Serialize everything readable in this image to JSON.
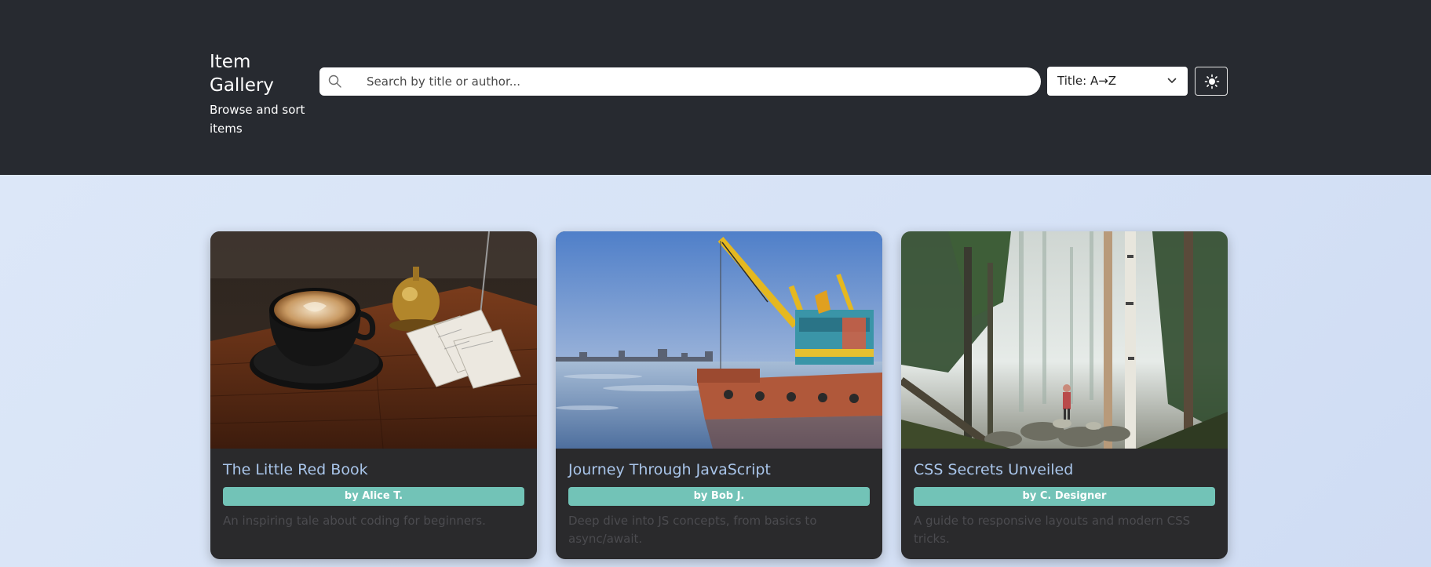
{
  "header": {
    "title": "Item Gallery",
    "subtitle": "Browse and sort items",
    "search": {
      "placeholder": "Search by title or author...",
      "value": "",
      "icon": "search-icon"
    },
    "sort": {
      "selected": "Title: A→Z",
      "icon": "chevron-down-icon"
    },
    "theme_toggle": {
      "icon": "sun-icon"
    }
  },
  "colors": {
    "header_bg": "#272a30",
    "page_bg": "#dde8f8",
    "card_bg": "#2a2a2c",
    "card_title": "#a9c5ea",
    "author_badge": "#72c3b7",
    "description": "#4b4b4f"
  },
  "cards": [
    {
      "title": "The Little Red Book",
      "author": "by Alice T.",
      "description": "An inspiring tale about coding for beginners.",
      "image": "coffee-cup-and-bell-photo"
    },
    {
      "title": "Journey Through JavaScript",
      "author": "by Bob J.",
      "description": "Deep dive into JS concepts, from basics to async/await.",
      "image": "harbor-crane-barge-photo"
    },
    {
      "title": "CSS Secrets Unveiled",
      "author": "by C. Designer",
      "description": "A guide to responsive layouts and modern CSS tricks.",
      "image": "misty-forest-photo"
    }
  ]
}
